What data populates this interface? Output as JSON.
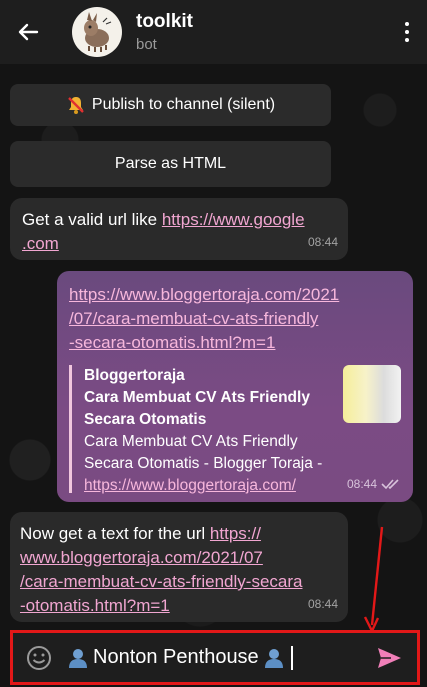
{
  "header": {
    "title": "toolkit",
    "subtitle": "bot"
  },
  "keyboard": {
    "publish_label": "Publish to channel (silent)",
    "publish_icon": "muted-bell-icon",
    "parse_label": "Parse as HTML"
  },
  "messages": {
    "m1": {
      "text": "Get a valid url like ",
      "link_line1": "https://www.google",
      "link_line2": ".com",
      "time": "08:44"
    },
    "m2": {
      "url_line1": "https://www.bloggertoraja.com/2021",
      "url_line2": "/07/cara-membuat-cv-ats-friendly",
      "url_line3": "-secara-otomatis.html?m=1",
      "preview_site": "Bloggertoraja",
      "preview_title_line1": "Cara Membuat CV Ats Friendly",
      "preview_title_line2": "Secara Otomatis",
      "preview_desc_line1": "Cara Membuat CV Ats Friendly",
      "preview_desc_line2": "Secara Otomatis - Blogger Toraja -",
      "preview_link": "https://www.bloggertoraja.com/",
      "time": "08:44"
    },
    "m3": {
      "text": "Now get a text for the url ",
      "link_line1": "https://",
      "link_line2": "www.bloggertoraja.com/2021/07",
      "link_line3": "/cara-membuat-cv-ats-friendly-secara",
      "link_line4": "-otomatis.html?m=1",
      "time": "08:44"
    }
  },
  "input": {
    "value": "Nonton Penthouse"
  },
  "colors": {
    "annotation_red": "#e21818",
    "send_accent": "#f07fb8"
  }
}
